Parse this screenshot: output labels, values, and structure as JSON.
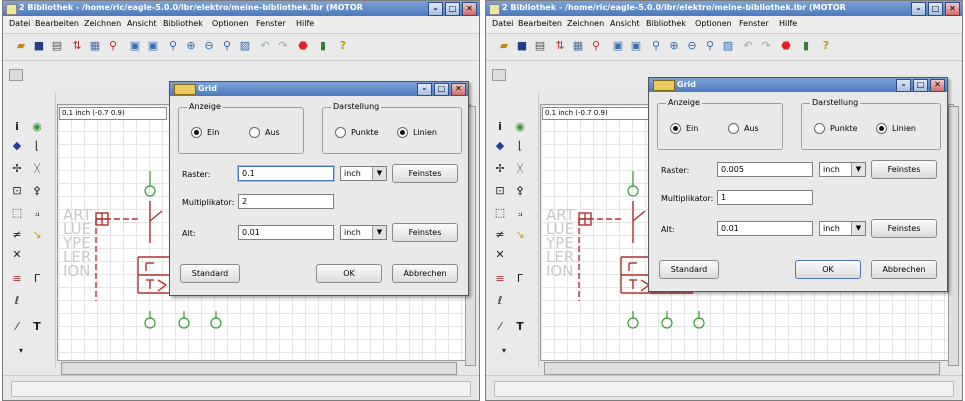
{
  "colors": {
    "titlebar": "#4c79bd",
    "schematic": "#b03030",
    "pin": "#3a9a3a"
  },
  "windows": [
    {
      "title": "2 Bibliothek - /home/ric/eagle-5.0.0/lbr/elektro/meine-bibliothek.lbr (MOTOR",
      "title_icon": "eagle-app-icon",
      "menus": [
        "Datei",
        "Bearbeiten",
        "Zeichnen",
        "Ansicht",
        "Bibliothek",
        "Optionen",
        "Fenster",
        "Hilfe"
      ],
      "coords": "0.1 inch (-0.7 0.9)",
      "ghost_text": [
        "ART",
        "LUE",
        "YPE",
        "LER",
        "ION"
      ],
      "dialog": {
        "title": "Grid",
        "anzeige_label": "Anzeige",
        "ein": "Ein",
        "aus": "Aus",
        "darstellung_label": "Darstellung",
        "punkte": "Punkte",
        "linien": "Linien",
        "raster_label": "Raster:",
        "raster_value": "0.1",
        "unit1": "inch",
        "feinstes1": "Feinstes",
        "multiplikator_label": "Multiplikator:",
        "multiplikator_value": "2",
        "alt_label": "Alt:",
        "alt_value": "0.01",
        "unit2": "inch",
        "feinstes2": "Feinstes",
        "standard": "Standard",
        "ok": "OK",
        "abbrechen": "Abbrechen"
      }
    },
    {
      "title": "2 Bibliothek - /home/ric/eagle-5.0.0/lbr/elektro/meine-bibliothek.lbr (MOTOR",
      "title_icon": "eagle-app-icon",
      "menus": [
        "Datei",
        "Bearbeiten",
        "Zeichnen",
        "Ansicht",
        "Bibliothek",
        "Optionen",
        "Fenster",
        "Hilfe"
      ],
      "coords": "0.1 inch (-0.7 0.9)",
      "ghost_text": [
        "ART",
        "LUE",
        "YPE",
        "LER",
        "ION"
      ],
      "dialog": {
        "title": "Grid",
        "anzeige_label": "Anzeige",
        "ein": "Ein",
        "aus": "Aus",
        "darstellung_label": "Darstellung",
        "punkte": "Punkte",
        "linien": "Linien",
        "raster_label": "Raster:",
        "raster_value": "0.005",
        "unit1": "inch",
        "feinstes1": "Feinstes",
        "multiplikator_label": "Multiplikator:",
        "multiplikator_value": "1",
        "alt_label": "Alt:",
        "alt_value": "0.01",
        "unit2": "inch",
        "feinstes2": "Feinstes",
        "standard": "Standard",
        "ok": "OK",
        "abbrechen": "Abbrechen"
      }
    }
  ]
}
